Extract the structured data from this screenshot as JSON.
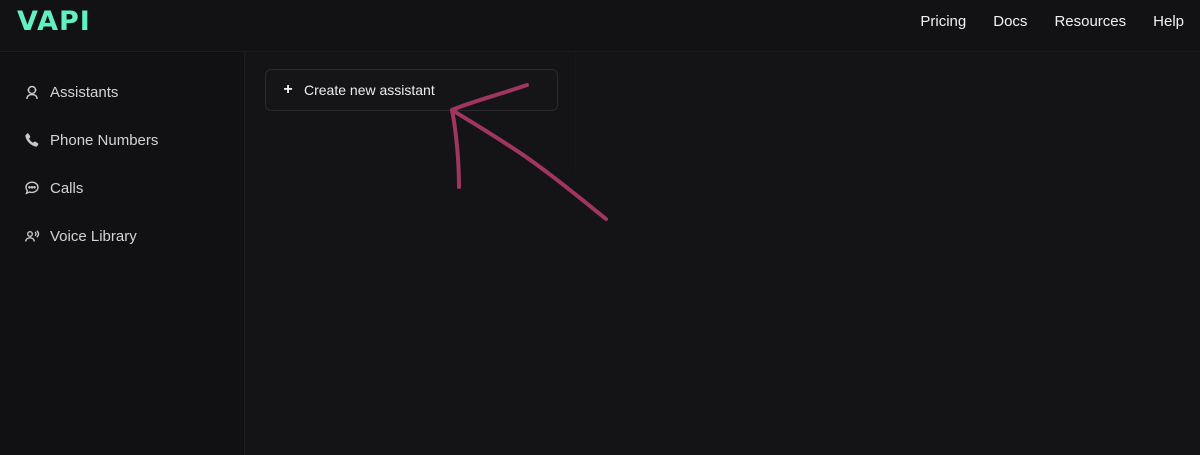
{
  "brand": {
    "logo_text": "VAPI",
    "accent_color": "#62f0c3"
  },
  "nav": {
    "items": [
      {
        "label": "Pricing"
      },
      {
        "label": "Docs"
      },
      {
        "label": "Resources"
      },
      {
        "label": "Help"
      }
    ]
  },
  "sidebar": {
    "items": [
      {
        "label": "Assistants",
        "icon": "assistant-icon"
      },
      {
        "label": "Phone Numbers",
        "icon": "phone-icon"
      },
      {
        "label": "Calls",
        "icon": "chat-bubble-icon"
      },
      {
        "label": "Voice Library",
        "icon": "voice-icon"
      }
    ]
  },
  "main": {
    "create_button_label": "Create new assistant",
    "create_button_icon": "plus-icon"
  },
  "annotation": {
    "arrow_color": "#a0355f"
  }
}
